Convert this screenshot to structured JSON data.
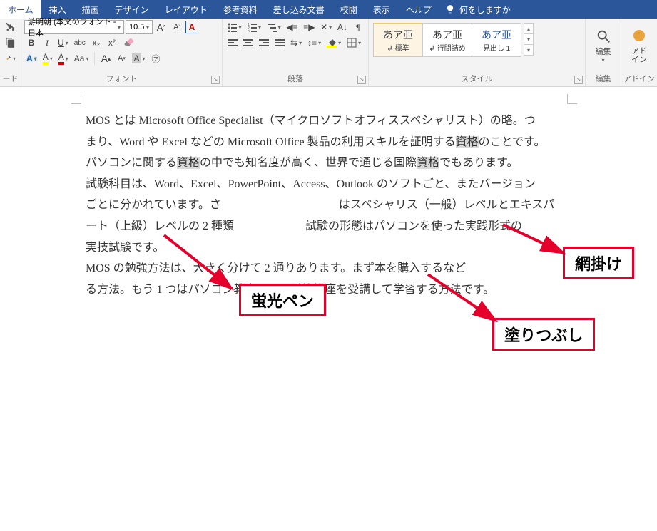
{
  "tabs": {
    "home": "ホーム",
    "insert": "挿入",
    "draw": "描画",
    "design": "デザイン",
    "layout": "レイアウト",
    "references": "参考資料",
    "mailings": "差し込み文書",
    "review": "校閲",
    "view": "表示",
    "help": "ヘルプ",
    "tellme": "何をしますか"
  },
  "font": {
    "name": "游明朝 (本文のフォント - 日本",
    "size": "10.5",
    "bold": "B",
    "italic": "I",
    "underline": "U",
    "strike": "abc",
    "sub": "x₂",
    "sup": "x²",
    "ruby": "A",
    "charbox": "囲",
    "charshade": "A",
    "bigA": "A",
    "smallA": "A",
    "aa": "Aa",
    "clear": "A",
    "enclose": "㋐",
    "boxed": "A",
    "grow": "A▴",
    "shrink": "A▾",
    "group_label": "フォント"
  },
  "para": {
    "bullets": "•––",
    "numbers": "1––",
    "multilist": "⁝––",
    "indent_dec": "≡◂",
    "indent_inc": "≡▸",
    "align_dist": "A↔",
    "sort": "A↓",
    "marks": "¶",
    "align_l": "≡",
    "align_c": "≡",
    "align_r": "≡",
    "align_j": "≡",
    "linespace": "↕≡",
    "shading": "◢",
    "borders": "田",
    "group_label": "段落"
  },
  "styles": {
    "items": [
      {
        "preview": "あア亜",
        "name": "↲ 標準"
      },
      {
        "preview": "あア亜",
        "name": "↲ 行間詰め"
      },
      {
        "preview": "あア亜",
        "name": "見出し 1"
      }
    ],
    "group_label": "スタイル"
  },
  "editing": {
    "find": "編集",
    "group_label": "編集"
  },
  "addin": {
    "label1": "アド",
    "label2": "イン",
    "group_label": "アドイン"
  },
  "clipboard": {
    "group_label": "ード"
  },
  "doc": {
    "line1a": "MOS とは Microsoft Office Specialist（マイクロソフトオフィススペシャリスト）の略。つ",
    "line2a": "まり、Word や Excel などの Microsoft Office 製品の利用スキルを証明する",
    "line2b": "資格",
    "line2c": "のことです。",
    "line3a": "パソコンに関する",
    "line3b": "資格",
    "line3c": "の中でも知名度が高く、世界で通じる国際",
    "line3d": "資格",
    "line3e": "でもあります。",
    "line4": "試験科目は、Word、Excel、PowerPoint、Access、Outlook のソフトごと、またバージョン",
    "line5a": "ごとに分かれています。さ",
    "line5c": "はスペシャリス（一般）レベルとエキスパ",
    "line6a": "ート（上級）レベルの 2 種類",
    "line6c": "試験の形態はパソコンを使った実践形式の",
    "line7": "実技試験です。",
    "line8a": "MOS の勉強方法は、大きく分けて 2 通りあります。まず本を購入するなど",
    "line9": "る方法。もう 1 つはパソコン教室などで対策講座を受講して学習する方法です。"
  },
  "callouts": {
    "highlighter": "蛍光ペン",
    "shading": "網掛け",
    "fill": "塗りつぶし"
  }
}
